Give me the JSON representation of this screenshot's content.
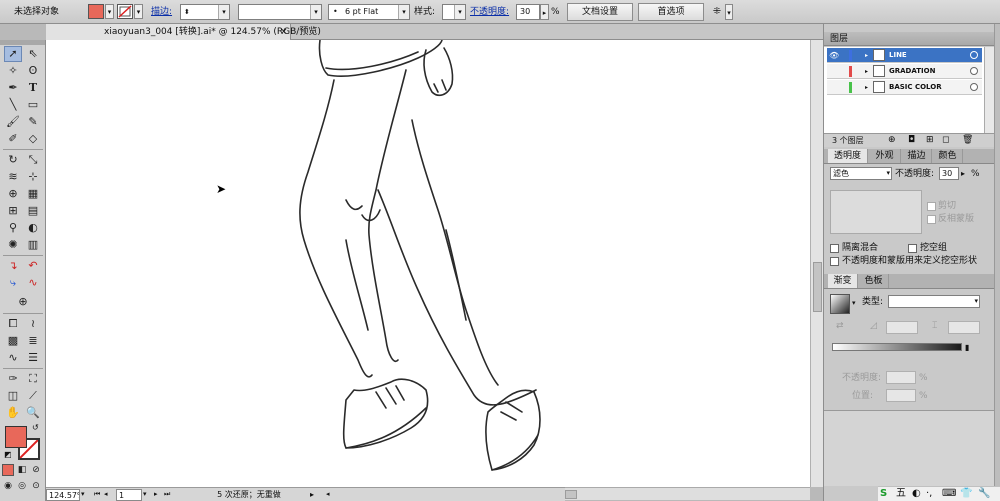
{
  "control_bar": {
    "selection_label": "未选择对象",
    "fill_color": "#e8685a",
    "stroke_label": "描边:",
    "brush_value": "6 pt Flat",
    "style_label": "样式:",
    "opacity_label": "不透明度:",
    "opacity_value": "30",
    "percent": "%",
    "doc_setup_button": "文档设置",
    "prefs_button": "首选项"
  },
  "document": {
    "tab_title": "xiaoyuan3_004 [转换].ai* @ 124.57% (RGB/预览)",
    "close_glyph": "×"
  },
  "tools": {
    "fill_color": "#e8685a",
    "icons": [
      "selection-icon",
      "direct-selection-icon",
      "magic-wand-icon",
      "lasso-icon",
      "pen-icon",
      "type-icon",
      "line-icon",
      "rectangle-icon",
      "paintbrush-icon",
      "pencil-icon",
      "blob-brush-icon",
      "eraser-icon",
      "rotate-icon",
      "scale-icon",
      "warp-icon",
      "free-transform-icon",
      "shape-builder-icon",
      "perspective-icon",
      "mesh-icon",
      "gradient-icon",
      "eyedropper-icon",
      "blend-icon",
      "symbol-sprayer-icon",
      "column-graph-icon",
      "artboard-icon",
      "slice-icon",
      "hand-icon",
      "zoom-icon"
    ]
  },
  "status_bar": {
    "zoom": "124.57%",
    "page": "1",
    "status_text": "5 次还原；无重做"
  },
  "layers_panel": {
    "title": "图层",
    "layers": [
      {
        "name": "LINE",
        "color": "#3d6fe0",
        "selected": true
      },
      {
        "name": "GRADATION",
        "color": "#e24b4b",
        "selected": false
      },
      {
        "name": "BASIC COLOR",
        "color": "#48c24a",
        "selected": false
      }
    ],
    "count_label": "3 个图层"
  },
  "transparency_panel": {
    "tabs": [
      "透明度",
      "外观",
      "描边",
      "颜色"
    ],
    "blend_mode": "滤色",
    "opacity_label": "不透明度:",
    "opacity_value": "30",
    "percent": "%",
    "clip_label": "剪切",
    "invert_mask_label": "反相蒙版",
    "isolate_blend_label": "隔离混合",
    "knockout_group_label": "挖空组",
    "opacity_mask_label": "不透明度和蒙版用来定义挖空形状"
  },
  "gradient_panel": {
    "tabs": [
      "渐变",
      "色板"
    ],
    "type_label": "类型:",
    "opacity_label": "不透明度:",
    "position_label": "位置:",
    "percent": "%"
  },
  "taskbar": {
    "ime_label": "五"
  }
}
